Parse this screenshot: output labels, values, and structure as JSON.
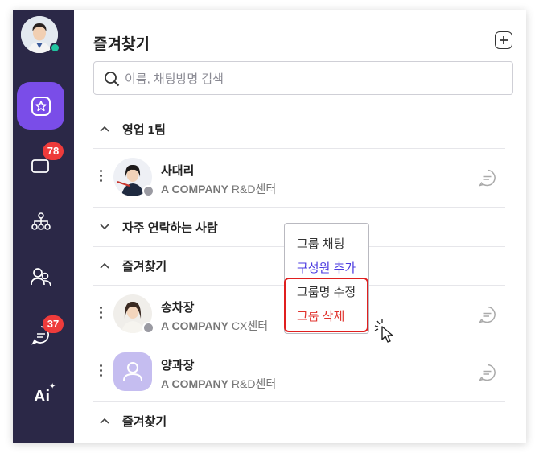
{
  "sidebar": {
    "badges": {
      "chat_rooms": "78",
      "messages": "37"
    },
    "ai_label": "Ai",
    "items": [
      {
        "icon": "star-icon",
        "active": true
      },
      {
        "icon": "chat-rooms-icon",
        "active": false
      },
      {
        "icon": "org-chart-icon",
        "active": false
      },
      {
        "icon": "people-icon",
        "active": false
      },
      {
        "icon": "message-icon",
        "active": false
      },
      {
        "icon": "ai-icon",
        "active": false
      }
    ]
  },
  "main": {
    "title": "즐겨찾기",
    "search": {
      "placeholder": "이름, 채팅방명 검색"
    },
    "groups": [
      {
        "label": "영업 1팀",
        "members": [
          {
            "name": "사대리",
            "company": "A COMPANY",
            "dept": "R&D센터"
          }
        ]
      },
      {
        "label": "자주 연락하는 사람",
        "members": []
      },
      {
        "label": "즐겨찾기",
        "members": [
          {
            "name": "송차장",
            "company": "A COMPANY",
            "dept": "CX센터"
          },
          {
            "name": "양과장",
            "company": "A COMPANY",
            "dept": "R&D센터"
          }
        ]
      },
      {
        "label": "즐겨찾기",
        "members": []
      }
    ]
  },
  "context_menu": {
    "items": [
      {
        "label": "그룹 채팅",
        "color": "#333333"
      },
      {
        "label": "구성원 추가",
        "color": "#4b3be0"
      },
      {
        "label": "그룹명 수정",
        "color": "#333333"
      },
      {
        "label": "그룹 삭제",
        "color": "#e0322c"
      }
    ]
  },
  "colors": {
    "sidebar_bg": "#2b2847",
    "accent": "#7a4de8",
    "badge": "#ee3b3b",
    "online": "#20c5a0",
    "highlight": "#e01f1f"
  }
}
